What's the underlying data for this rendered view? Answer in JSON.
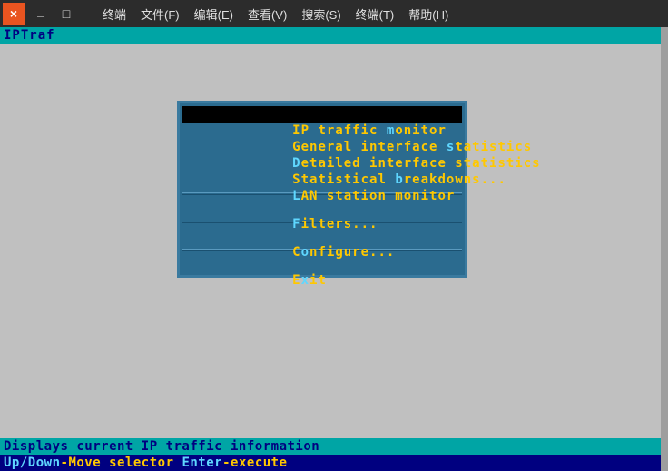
{
  "window": {
    "menubar": {
      "terminal": "终端",
      "file": "文件(F)",
      "edit": "编辑(E)",
      "view": "查看(V)",
      "search": "搜索(S)",
      "terminal2": "终端(T)",
      "help": "帮助(H)"
    }
  },
  "header": "IPTraf",
  "menu": {
    "items": [
      {
        "pre": "IP traffic ",
        "hot": "m",
        "post": "onitor"
      },
      {
        "pre": "General interface ",
        "hot": "s",
        "post": "tatistics"
      },
      {
        "pre": "",
        "hot": "D",
        "post": "etailed interface statistics"
      },
      {
        "pre": "Statistical ",
        "hot": "b",
        "post": "reakdowns..."
      },
      {
        "pre": "",
        "hot": "L",
        "post": "AN station monitor"
      },
      {
        "pre": "",
        "hot": "F",
        "post": "ilters..."
      },
      {
        "pre": "C",
        "hot": "o",
        "post": "nfigure..."
      },
      {
        "pre": "E",
        "hot": "x",
        "post": "it"
      }
    ]
  },
  "status": "Displays current IP traffic information",
  "help": {
    "key1": "Up/Down",
    "text1": "-Move selector  ",
    "key2": "Enter",
    "text2": "-execute"
  }
}
